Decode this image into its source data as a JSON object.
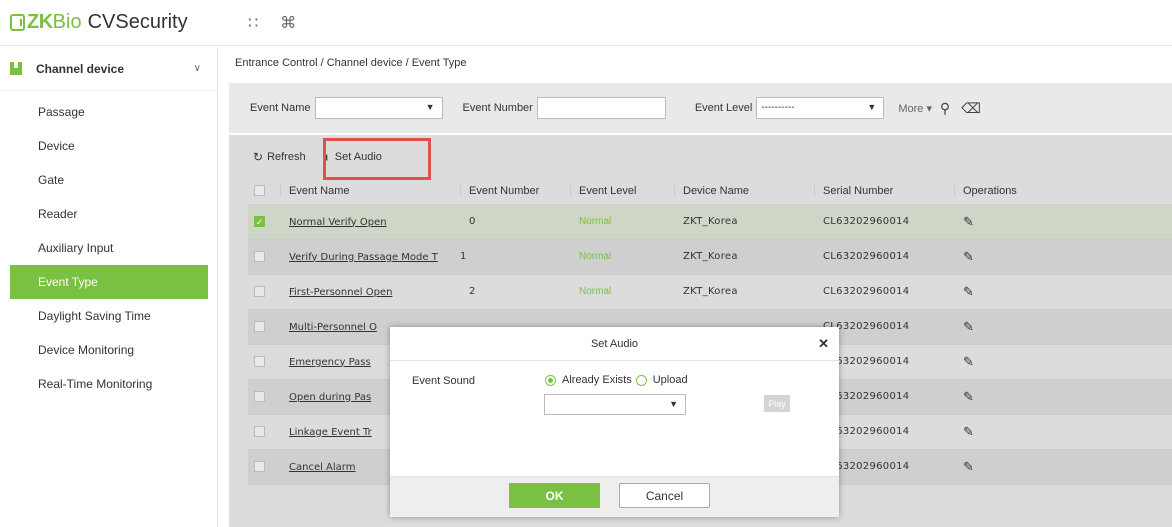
{
  "app": {
    "logo_zk": "ZK",
    "logo_bio": "Bio",
    "logo_rest": "CVSecurity",
    "top_icons": [
      "grid-icon",
      "command-icon"
    ]
  },
  "sidebar": {
    "module": "Channel device",
    "items": [
      {
        "label": "Passage"
      },
      {
        "label": "Device"
      },
      {
        "label": "Gate"
      },
      {
        "label": "Reader"
      },
      {
        "label": "Auxiliary Input"
      },
      {
        "label": "Event Type",
        "active": true
      },
      {
        "label": "Daylight Saving Time"
      },
      {
        "label": "Device Monitoring"
      },
      {
        "label": "Real-Time Monitoring"
      }
    ]
  },
  "breadcrumb": "Entrance Control / Channel device / Event Type",
  "filter": {
    "event_name_label": "Event Name",
    "event_number_label": "Event Number",
    "event_level_label": "Event Level",
    "event_level_value": "----------",
    "more_label": "More"
  },
  "toolbar": {
    "refresh": "Refresh",
    "set_audio": "Set Audio"
  },
  "table": {
    "columns": [
      "Event Name",
      "Event Number",
      "Event Level",
      "Device Name",
      "Serial Number",
      "Operations"
    ],
    "rows": [
      {
        "name": "Normal Verify Open",
        "number": "0",
        "level": "Normal",
        "device": "ZKT_Korea",
        "serial": "CL63202960014",
        "checked": true
      },
      {
        "name": "Verify During Passage Mode T",
        "number": "1",
        "level": "Normal",
        "device": "ZKT_Korea",
        "serial": "CL63202960014"
      },
      {
        "name": "First-Personnel Open",
        "number": "2",
        "level": "Normal",
        "device": "ZKT_Korea",
        "serial": "CL63202960014"
      },
      {
        "name": "Multi-Personnel O",
        "number": "",
        "level": "",
        "device": "",
        "serial": "CL63202960014"
      },
      {
        "name": "Emergency Pass",
        "number": "",
        "level": "",
        "device": "",
        "serial": "CL63202960014"
      },
      {
        "name": "Open during Pas",
        "number": "",
        "level": "",
        "device": "",
        "serial": "CL63202960014"
      },
      {
        "name": "Linkage Event Tr",
        "number": "",
        "level": "",
        "device": "",
        "serial": "CL63202960014"
      },
      {
        "name": "Cancel Alarm",
        "number": "",
        "level": "",
        "device": "",
        "serial": "CL63202960014"
      }
    ]
  },
  "modal": {
    "title": "Set Audio",
    "event_sound_label": "Event Sound",
    "opt_exists": "Already Exists",
    "opt_upload": "Upload",
    "play": "Play",
    "ok": "OK",
    "cancel": "Cancel"
  },
  "colors": {
    "accent": "#7ac143",
    "highlight": "#e0504d"
  }
}
